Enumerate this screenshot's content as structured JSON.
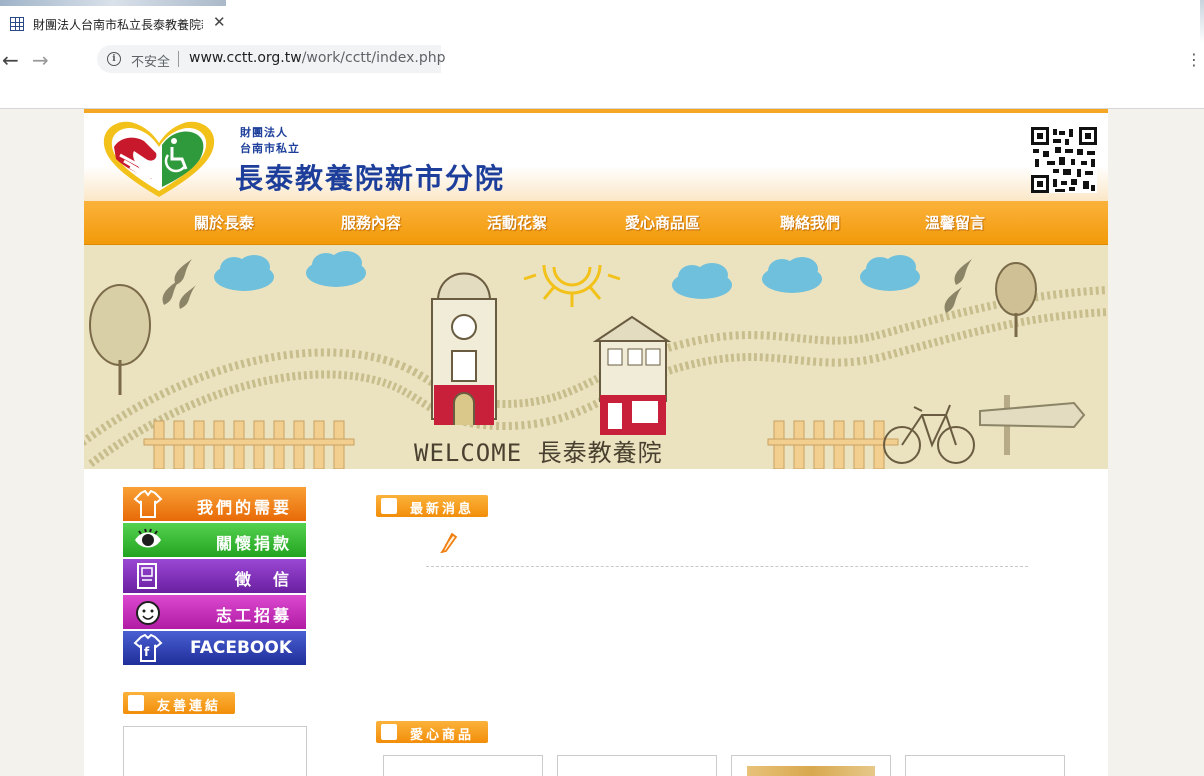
{
  "browser": {
    "tab_title": "財團法人台南市私立長泰教養院新",
    "tab_close": "✕",
    "security_label": "不安全",
    "url_domain": "www.cctt.org.tw",
    "url_path": "/work/cctt/index.php"
  },
  "header": {
    "org_line1": "財團法人",
    "org_line2": "台南市私立",
    "org_name": "長泰教養院新市分院"
  },
  "nav": [
    "關於長泰",
    "服務內容",
    "活動花絮",
    "愛心商品區",
    "聯絡我們",
    "溫馨留言"
  ],
  "banner": {
    "welcome_text": "WELCOME 長泰教養院"
  },
  "sidebar": {
    "buttons": [
      {
        "label": "我們的需要",
        "color": "#f07f10"
      },
      {
        "label": "關懷捐款",
        "color": "#2db52b"
      },
      {
        "label": "徵　信",
        "color": "#7a2fb0"
      },
      {
        "label": "志工招募",
        "color": "#c52fb8"
      },
      {
        "label": "FACEBOOK",
        "color": "#2d44b5"
      }
    ],
    "links_title": "友善連結"
  },
  "main": {
    "news_title": "最新消息",
    "products_title": "愛心商品"
  }
}
